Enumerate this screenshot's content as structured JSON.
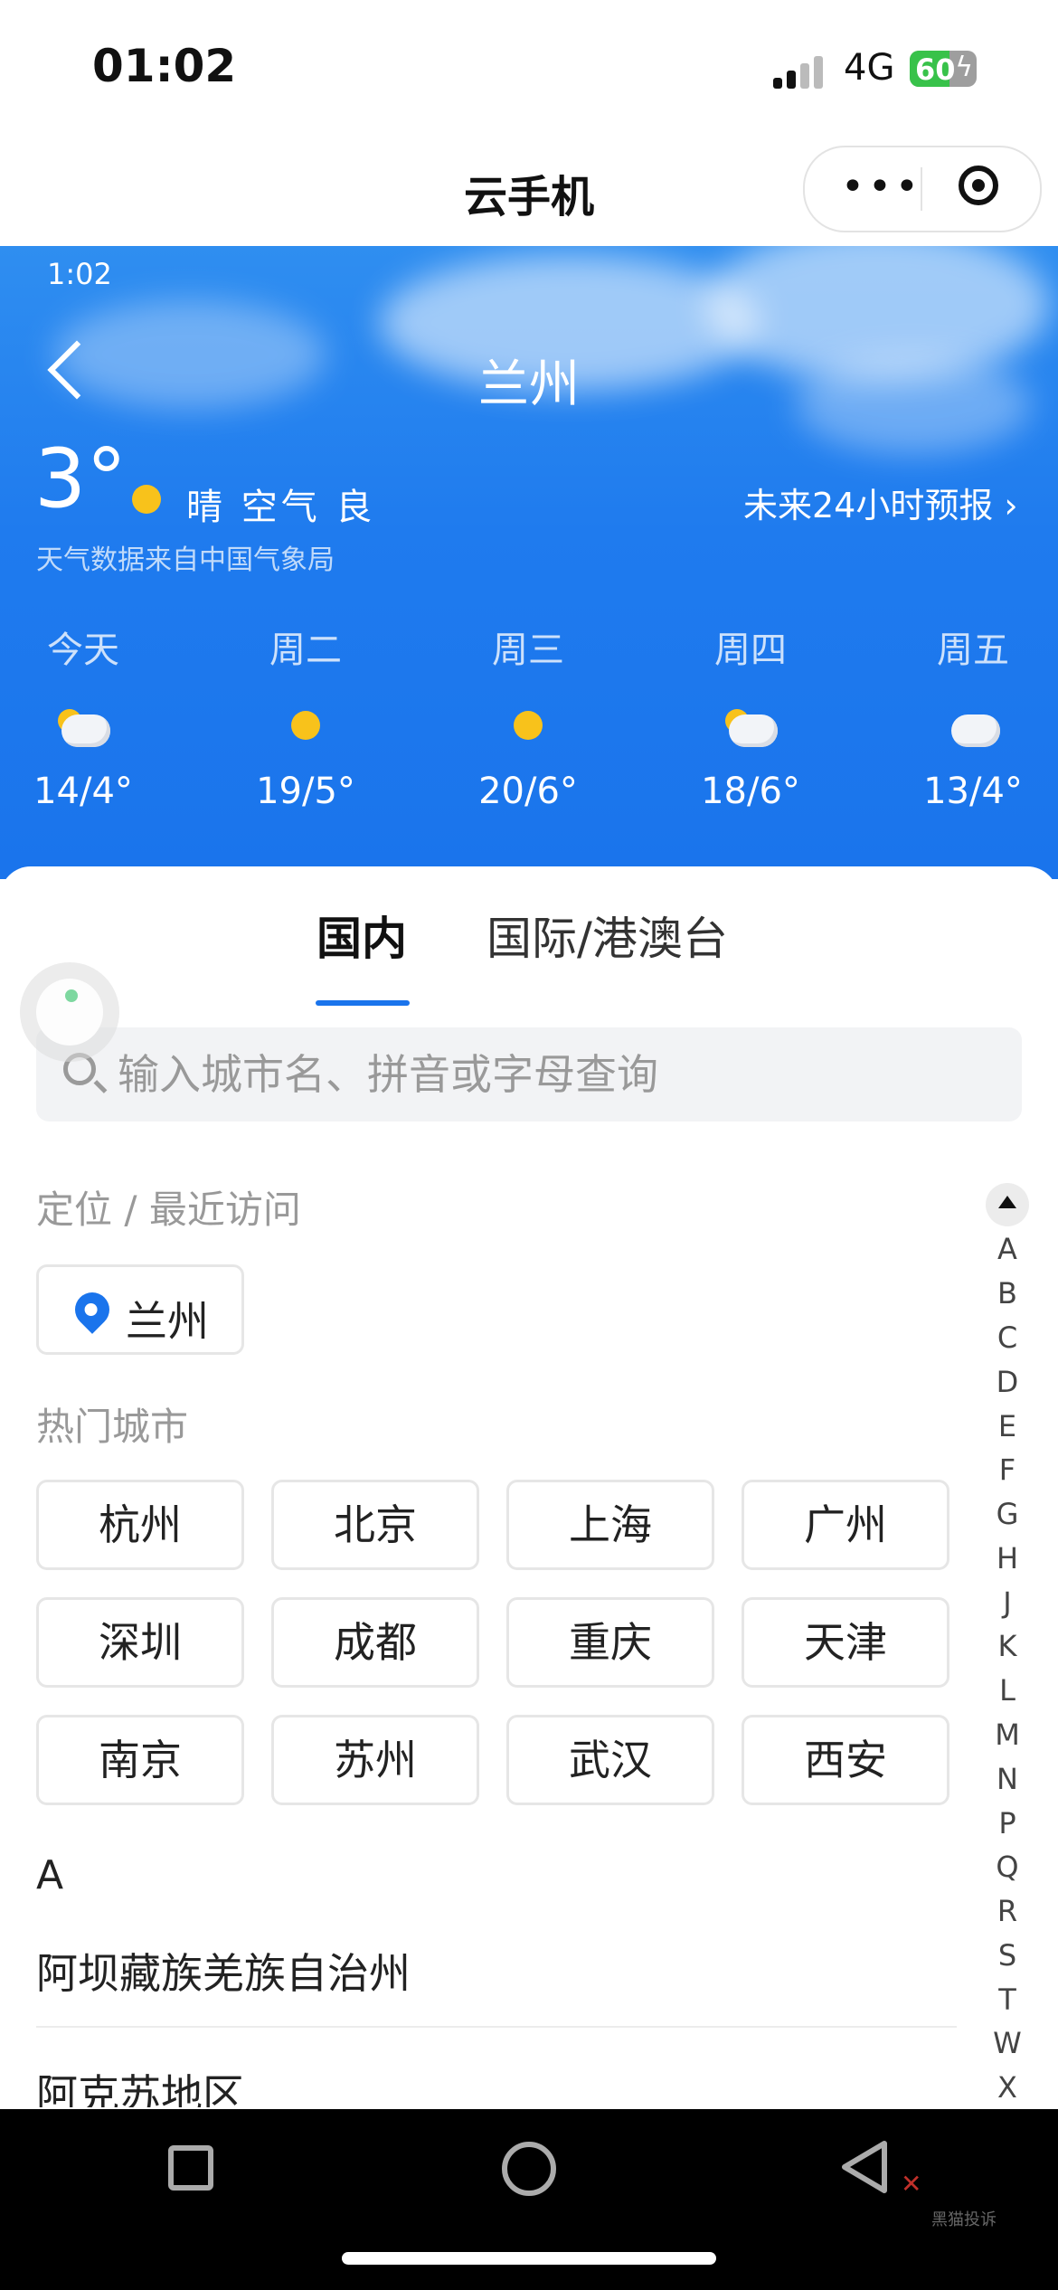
{
  "status_bar": {
    "time": "01:02",
    "network": "4G",
    "battery": "60",
    "battery_level": 0.6
  },
  "mini_program": {
    "title": "云手机"
  },
  "weather": {
    "inner_time": "1:02",
    "city": "兰州",
    "temperature": "3°",
    "condition": "晴 空气 良",
    "forecast_link": "未来24小时预报 ›",
    "source": "天气数据来自中国气象局",
    "days": [
      {
        "name": "今天",
        "range": "14/4°",
        "icon": "partly-cloudy-icon"
      },
      {
        "name": "周二",
        "range": "19/5°",
        "icon": "sun-icon"
      },
      {
        "name": "周三",
        "range": "20/6°",
        "icon": "sun-icon"
      },
      {
        "name": "周四",
        "range": "18/6°",
        "icon": "partly-cloudy-icon"
      },
      {
        "name": "周五",
        "range": "13/4°",
        "icon": "cloud-icon"
      }
    ],
    "sun_color": "#f8c21b",
    "header_color": "#1a74ec"
  },
  "tabs": {
    "domestic": "国内",
    "international": "国际/港澳台"
  },
  "search": {
    "placeholder": "输入城市名、拼音或字母查询"
  },
  "recent": {
    "label": "定位 / 最近访问",
    "city": "兰州"
  },
  "hot": {
    "label": "热门城市",
    "cities": [
      "杭州",
      "北京",
      "上海",
      "广州",
      "深圳",
      "成都",
      "重庆",
      "天津",
      "南京",
      "苏州",
      "武汉",
      "西安"
    ]
  },
  "city_list": {
    "letter": "A",
    "items": [
      "阿坝藏族羌族自治州",
      "阿克苏地区"
    ]
  },
  "index_letters": [
    "A",
    "B",
    "C",
    "D",
    "E",
    "F",
    "G",
    "H",
    "J",
    "K",
    "L",
    "M",
    "N",
    "P",
    "Q",
    "R",
    "S",
    "T",
    "W",
    "X"
  ],
  "watermark": "黑猫投诉"
}
